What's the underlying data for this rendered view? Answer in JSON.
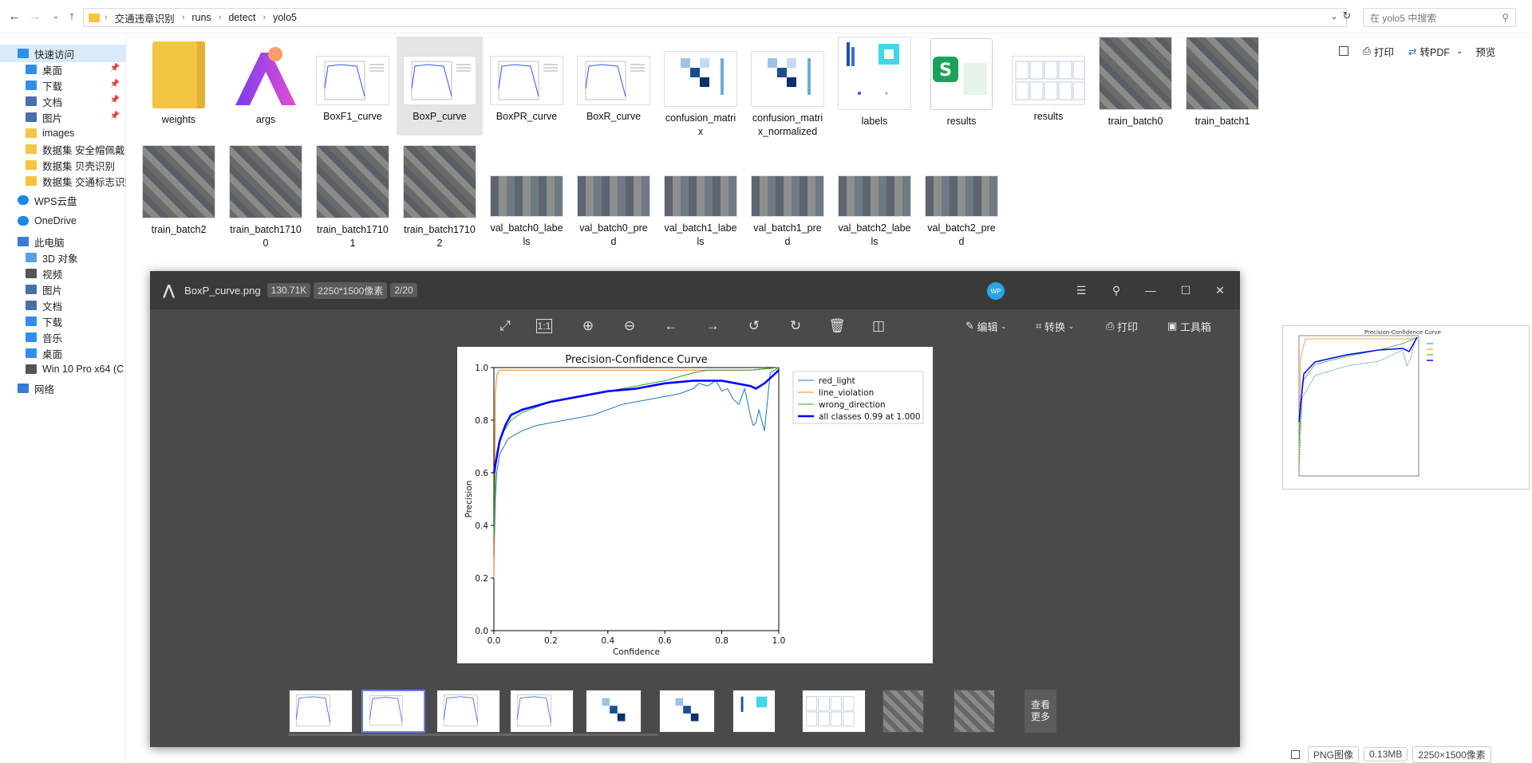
{
  "address": {
    "path": [
      "交通违章识别",
      "runs",
      "detect",
      "yolo5"
    ],
    "search_placeholder": "在 yolo5 中搜索"
  },
  "sidebar": {
    "items": [
      {
        "label": "快速访问",
        "icon": "star-icon",
        "pinned": false
      },
      {
        "label": "桌面",
        "icon": "desktop-icon",
        "pinned": true
      },
      {
        "label": "下载",
        "icon": "download-icon",
        "pinned": true
      },
      {
        "label": "文档",
        "icon": "document-icon",
        "pinned": true
      },
      {
        "label": "图片",
        "icon": "picture-icon",
        "pinned": true
      },
      {
        "label": "images",
        "icon": "folder-icon",
        "pinned": false
      },
      {
        "label": "数据集 安全帽佩戴",
        "icon": "folder-icon",
        "pinned": false
      },
      {
        "label": "数据集 贝壳识别",
        "icon": "folder-icon",
        "pinned": false
      },
      {
        "label": "数据集 交通标志识别",
        "icon": "folder-icon",
        "pinned": false
      },
      {
        "label": "WPS云盘",
        "icon": "cloud-icon",
        "pinned": false
      },
      {
        "label": "OneDrive",
        "icon": "onedrive-icon",
        "pinned": false
      },
      {
        "label": "此电脑",
        "icon": "computer-icon",
        "pinned": false
      },
      {
        "label": "3D 对象",
        "icon": "cube-icon",
        "pinned": false
      },
      {
        "label": "视频",
        "icon": "video-icon",
        "pinned": false
      },
      {
        "label": "图片",
        "icon": "picture-icon",
        "pinned": false
      },
      {
        "label": "文档",
        "icon": "document-icon",
        "pinned": false
      },
      {
        "label": "下载",
        "icon": "download-icon",
        "pinned": false
      },
      {
        "label": "音乐",
        "icon": "music-icon",
        "pinned": false
      },
      {
        "label": "桌面",
        "icon": "desktop-icon",
        "pinned": false
      },
      {
        "label": "Win 10 Pro x64 (C",
        "icon": "drive-icon",
        "pinned": false
      },
      {
        "label": "网络",
        "icon": "network-icon",
        "pinned": false
      }
    ]
  },
  "files": {
    "row1": [
      {
        "name": "weights",
        "kind": "folder"
      },
      {
        "name": "args",
        "kind": "app"
      },
      {
        "name": "BoxF1_curve",
        "kind": "chart"
      },
      {
        "name": "BoxP_curve",
        "kind": "chart",
        "selected": true
      },
      {
        "name": "BoxPR_curve",
        "kind": "chart"
      },
      {
        "name": "BoxR_curve",
        "kind": "chart"
      },
      {
        "name": "confusion_matri\nx",
        "kind": "matrix"
      },
      {
        "name": "confusion_matri\nx_normalized",
        "kind": "matrix"
      },
      {
        "name": "labels",
        "kind": "labels"
      },
      {
        "name": "results",
        "kind": "sheet"
      },
      {
        "name": "results",
        "kind": "grid"
      },
      {
        "name": "train_batch0",
        "kind": "photo"
      },
      {
        "name": "train_batch1",
        "kind": "photo"
      }
    ],
    "row2": [
      {
        "name": "train_batch2",
        "kind": "photo"
      },
      {
        "name": "train_batch1710\n0",
        "kind": "photo"
      },
      {
        "name": "train_batch1710\n1",
        "kind": "photo"
      },
      {
        "name": "train_batch1710\n2",
        "kind": "photo"
      },
      {
        "name": "val_batch0_labe\nls",
        "kind": "wide"
      },
      {
        "name": "val_batch0_pre\nd",
        "kind": "wide"
      },
      {
        "name": "val_batch1_labe\nls",
        "kind": "wide"
      },
      {
        "name": "val_batch1_pre\nd",
        "kind": "wide"
      },
      {
        "name": "val_batch2_labe\nls",
        "kind": "wide"
      },
      {
        "name": "val_batch2_pre\nd",
        "kind": "wide"
      }
    ]
  },
  "viewer": {
    "filename": "BoxP_curve.png",
    "filesize": "130.71K",
    "dimensions": "2250*1500像素",
    "index": "2/20",
    "avatar": "WP",
    "tools": {
      "edit": "编辑",
      "convert": "转换",
      "print": "打印",
      "toolbox": "工具箱"
    },
    "see_more": "查看\n更多"
  },
  "preview_pane": {
    "print": "打印",
    "to_pdf": "转PDF",
    "preview": "预览"
  },
  "status": {
    "type": "PNG图像",
    "size": "0.13MB",
    "dims": "2250×1500像素"
  },
  "colors": {
    "red_light": "#1f77b4",
    "line_violation": "#ff7f0e",
    "wrong_direction": "#2ca02c",
    "all_classes": "#0000ff",
    "viewer_bg": "#4a4a4a",
    "selection": "#e5e5e5"
  },
  "chart_data": {
    "type": "line",
    "title": "Precision-Confidence Curve",
    "xlabel": "Confidence",
    "ylabel": "Precision",
    "xlim": [
      0,
      1
    ],
    "ylim": [
      0,
      1
    ],
    "xticks": [
      "0.0",
      "0.2",
      "0.4",
      "0.6",
      "0.8",
      "1.0"
    ],
    "yticks": [
      "0.0",
      "0.2",
      "0.4",
      "0.6",
      "0.8",
      "1.0"
    ],
    "legend_position": "top-right-outside",
    "series": [
      {
        "name": "red_light",
        "color": "#1f77b4",
        "width": 1,
        "x": [
          0,
          0.005,
          0.01,
          0.02,
          0.05,
          0.1,
          0.15,
          0.2,
          0.25,
          0.3,
          0.35,
          0.4,
          0.45,
          0.5,
          0.55,
          0.6,
          0.65,
          0.7,
          0.72,
          0.75,
          0.78,
          0.8,
          0.82,
          0.84,
          0.86,
          0.88,
          0.9,
          0.91,
          0.92,
          0.93,
          0.95,
          0.97,
          1.0
        ],
        "y": [
          0.25,
          0.5,
          0.6,
          0.67,
          0.73,
          0.76,
          0.78,
          0.79,
          0.8,
          0.81,
          0.82,
          0.84,
          0.86,
          0.87,
          0.88,
          0.89,
          0.9,
          0.92,
          0.94,
          0.93,
          0.95,
          0.91,
          0.92,
          0.88,
          0.86,
          0.92,
          0.82,
          0.78,
          0.79,
          0.84,
          0.76,
          0.98,
          1.0
        ]
      },
      {
        "name": "line_violation",
        "color": "#ff7f0e",
        "width": 1,
        "x": [
          0,
          0.005,
          0.01,
          0.02,
          0.05,
          0.1,
          0.5,
          0.9,
          1.0
        ],
        "y": [
          0.2,
          0.9,
          0.97,
          0.99,
          0.99,
          0.99,
          0.99,
          0.99,
          1.0
        ]
      },
      {
        "name": "wrong_direction",
        "color": "#2ca02c",
        "width": 1,
        "x": [
          0,
          0.005,
          0.01,
          0.03,
          0.06,
          0.1,
          0.2,
          0.3,
          0.4,
          0.5,
          0.6,
          0.7,
          0.75,
          0.8,
          0.85,
          0.9,
          1.0
        ],
        "y": [
          0.35,
          0.6,
          0.68,
          0.75,
          0.8,
          0.83,
          0.87,
          0.89,
          0.91,
          0.93,
          0.95,
          0.98,
          0.99,
          0.99,
          0.99,
          0.99,
          1.0
        ]
      },
      {
        "name": "all classes 0.99 at 1.000",
        "color": "#0000ff",
        "width": 2.6,
        "x": [
          0,
          0.01,
          0.02,
          0.04,
          0.06,
          0.1,
          0.2,
          0.3,
          0.4,
          0.5,
          0.6,
          0.7,
          0.75,
          0.8,
          0.85,
          0.9,
          0.92,
          0.95,
          0.98,
          1.0
        ],
        "y": [
          0.6,
          0.66,
          0.72,
          0.78,
          0.82,
          0.84,
          0.87,
          0.89,
          0.91,
          0.92,
          0.94,
          0.95,
          0.95,
          0.95,
          0.94,
          0.93,
          0.92,
          0.94,
          0.97,
          0.99
        ]
      }
    ]
  }
}
